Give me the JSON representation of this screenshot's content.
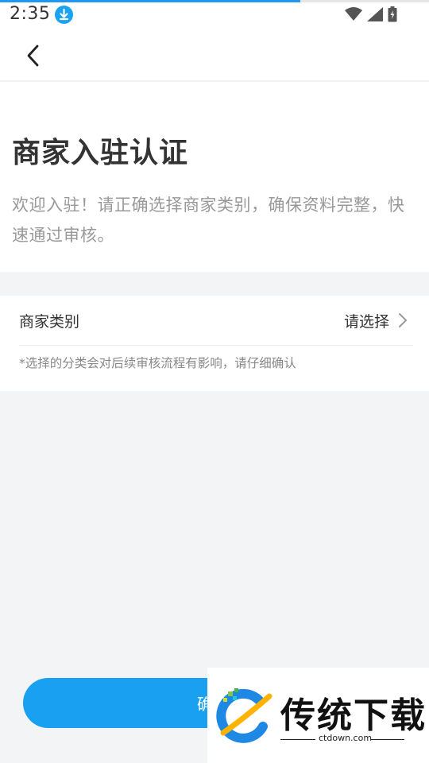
{
  "status_bar": {
    "time": "2:35",
    "download_progress": 0.7
  },
  "header": {
    "back_icon": "chevron-left-icon"
  },
  "intro": {
    "title": "商家入驻认证",
    "description": "欢迎入驻！请正确选择商家类别，确保资料完整，快速通过审核。"
  },
  "category": {
    "label": "商家类别",
    "value": "请选择",
    "hint": "*选择的分类会对后续审核流程有影响，请仔细确认"
  },
  "confirm": {
    "label": "确认"
  },
  "watermark": {
    "brand": "传统下载",
    "url": "ctdown.com"
  },
  "colors": {
    "accent": "#19a0f1",
    "background": "#f2f4f5"
  }
}
